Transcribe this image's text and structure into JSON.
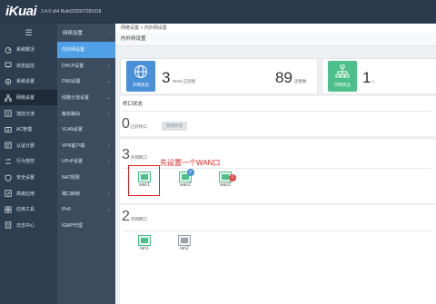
{
  "app": {
    "logo": "iKuai",
    "version": "3.4.0 x64 Build202007281918"
  },
  "sidebar": {
    "toggle_icon": "menu-icon",
    "items": [
      {
        "label": "系统概况",
        "icon": "gauge-icon"
      },
      {
        "label": "状态监控",
        "icon": "monitor-icon"
      },
      {
        "label": "系统设置",
        "icon": "gear-icon"
      },
      {
        "label": "网络设置",
        "icon": "network-icon",
        "active": true
      },
      {
        "label": "流控分流",
        "icon": "flow-icon"
      },
      {
        "label": "AC管理",
        "icon": "ac-icon"
      },
      {
        "label": "认证计费",
        "icon": "auth-icon"
      },
      {
        "label": "行为管控",
        "icon": "behavior-icon"
      },
      {
        "label": "安全设置",
        "icon": "shield-icon"
      },
      {
        "label": "高级应用",
        "icon": "advanced-icon"
      },
      {
        "label": "应用工具",
        "icon": "tools-icon"
      },
      {
        "label": "日志中心",
        "icon": "log-icon"
      }
    ]
  },
  "submenu": {
    "header": "网络设置",
    "items": [
      {
        "label": "内外网设置",
        "active": true,
        "chevron": false
      },
      {
        "label": "DHCP设置",
        "chevron": true
      },
      {
        "label": "DNS设置",
        "chevron": true
      },
      {
        "label": "线路分流设置",
        "chevron": true
      },
      {
        "label": "静态路由",
        "chevron": true
      },
      {
        "label": "VLAN设置",
        "chevron": false
      },
      {
        "label": "VPN客户端",
        "chevron": true
      },
      {
        "label": "UPnP设置",
        "chevron": true
      },
      {
        "label": "NAT规则",
        "chevron": false
      },
      {
        "label": "端口映射",
        "chevron": true
      },
      {
        "label": "IPv6",
        "chevron": true
      },
      {
        "label": "IGMP代理",
        "chevron": false
      }
    ]
  },
  "main": {
    "breadcrumb": "网络设置 > 内外网设置",
    "title": "内外网设置",
    "stats": {
      "wan_label": "外网状态",
      "wan_count": "3",
      "wan_unit": "WAN 已连接",
      "conn_count": "89",
      "conn_unit": "连接数",
      "lan_label": "内网状态",
      "lan_count": "1",
      "lan_unit": "L"
    },
    "bridge": {
      "title": "桥口状态",
      "count": "0",
      "unit": "已开桥口",
      "button": "新增桥接"
    },
    "wan": {
      "count": "3",
      "unit": "外网网口",
      "ports": [
        {
          "name": "wan1",
          "badge": ""
        },
        {
          "name": "wan2",
          "badge": "✓"
        },
        {
          "name": "wan3",
          "badge": "!"
        }
      ],
      "annotation": "先设置一个WAN口"
    },
    "lan": {
      "count": "2",
      "unit": "内网网口",
      "ports": [
        {
          "name": "lan1"
        },
        {
          "name": "lan2"
        }
      ]
    }
  },
  "colors": {
    "topbar": "#2b3a4d",
    "accent": "#4fa0e6",
    "wan_icon": "#4a90d9",
    "lan_icon": "#4dbf8a",
    "annotation": "#e02020",
    "port_green": "#4dbf8a",
    "port_gray": "#9aa3ad"
  }
}
